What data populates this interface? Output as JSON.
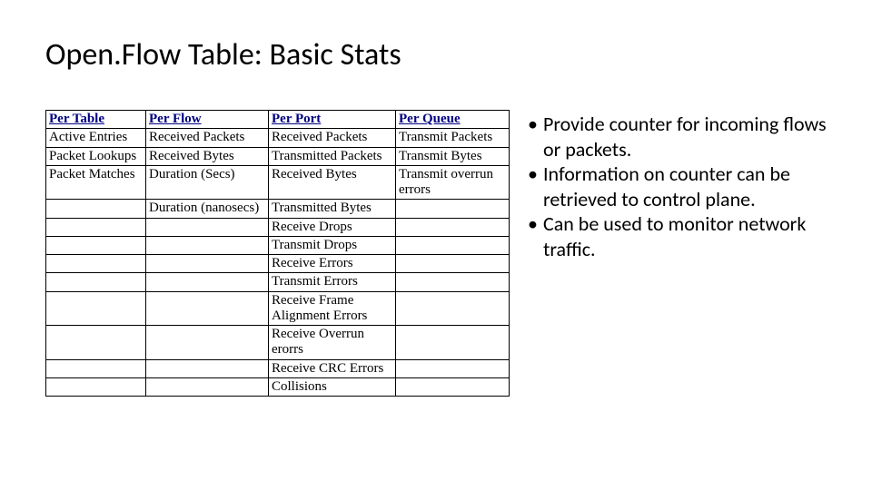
{
  "title": "Open.Flow Table: Basic Stats",
  "table": {
    "headers": [
      "Per Table",
      "Per Flow",
      "Per Port",
      "Per Queue"
    ],
    "rows": [
      [
        "Active Entries",
        "Received Packets",
        "Received Packets",
        "Transmit Packets"
      ],
      [
        "Packet Lookups",
        "Received Bytes",
        "Transmitted Packets",
        "Transmit Bytes"
      ],
      [
        "Packet Matches",
        "Duration (Secs)",
        "Received Bytes",
        "Transmit overrun errors"
      ],
      [
        "",
        "Duration (nanosecs)",
        "Transmitted Bytes",
        ""
      ],
      [
        "",
        "",
        "Receive Drops",
        ""
      ],
      [
        "",
        "",
        "Transmit Drops",
        ""
      ],
      [
        "",
        "",
        "Receive Errors",
        ""
      ],
      [
        "",
        "",
        "Transmit Errors",
        ""
      ],
      [
        "",
        "",
        "Receive Frame Alignment Errors",
        ""
      ],
      [
        "",
        "",
        "Receive Overrun erorrs",
        ""
      ],
      [
        "",
        "",
        "Receive CRC Errors",
        ""
      ],
      [
        "",
        "",
        "Collisions",
        ""
      ]
    ]
  },
  "bullets": [
    "Provide counter for incoming flows or packets.",
    "Information on counter can be retrieved to control plane.",
    "Can be used to monitor network traffic."
  ]
}
